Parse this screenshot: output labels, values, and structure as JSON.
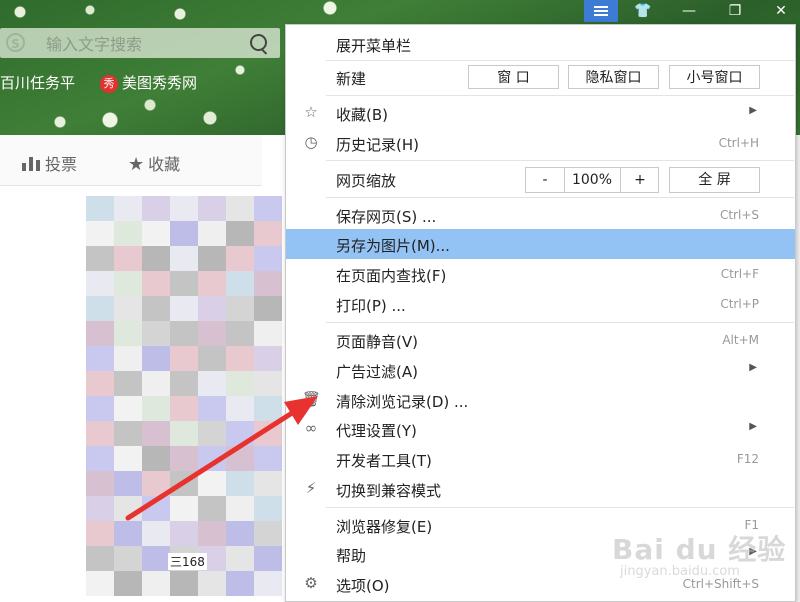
{
  "search": {
    "placeholder": "输入文字搜索"
  },
  "bookmarks": [
    {
      "label": "百川任务平"
    },
    {
      "label": "美图秀秀网",
      "icon_text": "秀"
    }
  ],
  "page_tabs": [
    {
      "label": "投票",
      "icon": "bar-chart-icon"
    },
    {
      "label": "收藏",
      "icon": "star-icon"
    }
  ],
  "mosaic_fragment": {
    "text": "三168"
  },
  "menu": {
    "expand_menubar": "展开菜单栏",
    "new_label": "新建",
    "new_window": "窗 口",
    "new_private": "隐私窗口",
    "new_small": "小号窗口",
    "favorites": "收藏(B)",
    "history": "历史记录(H)",
    "history_shortcut": "Ctrl+H",
    "zoom_label": "网页缩放",
    "zoom_minus": "-",
    "zoom_value": "100%",
    "zoom_plus": "+",
    "fullscreen": "全 屏",
    "save_page": "保存网页(S) ...",
    "save_page_shortcut": "Ctrl+S",
    "save_as_image": "另存为图片(M)...",
    "find_in_page": "在页面内查找(F)",
    "find_shortcut": "Ctrl+F",
    "print": "打印(P) ...",
    "print_shortcut": "Ctrl+P",
    "mute": "页面静音(V)",
    "mute_shortcut": "Alt+M",
    "ad_filter": "广告过滤(A)",
    "clear_history": "清除浏览记录(D) ...",
    "proxy": "代理设置(Y)",
    "devtools": "开发者工具(T)",
    "devtools_shortcut": "F12",
    "compat_mode": "切换到兼容模式",
    "repair": "浏览器修复(E)",
    "repair_shortcut": "F1",
    "help": "帮助",
    "options": "选项(O)",
    "options_shortcut": "Ctrl+Shift+S"
  },
  "watermark": {
    "main": "Bai du 经验",
    "sub": "jingyan.baidu.com"
  },
  "colors": {
    "highlight": "#93c2f4",
    "menu_button_active": "#3d7bd4",
    "arrow": "#e8322f"
  }
}
